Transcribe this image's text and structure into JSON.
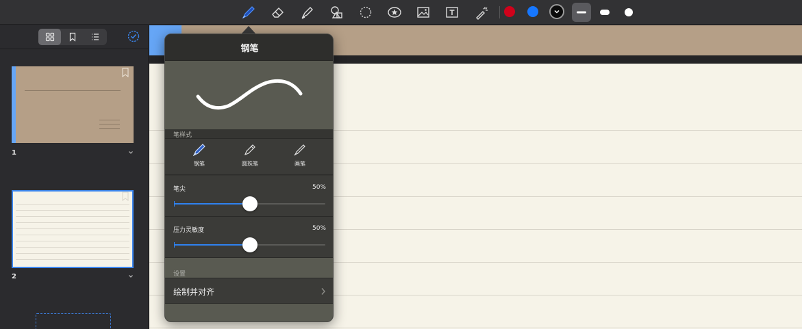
{
  "toolbar": {
    "tools": [
      {
        "id": "pen",
        "icon": "fountain-pen-icon",
        "active": true
      },
      {
        "id": "eraser",
        "icon": "eraser-icon"
      },
      {
        "id": "highlighter",
        "icon": "highlighter-icon"
      },
      {
        "id": "shapes",
        "icon": "shapes-icon"
      },
      {
        "id": "lasso",
        "icon": "lasso-icon"
      },
      {
        "id": "sticker",
        "icon": "star-sticker-icon"
      },
      {
        "id": "image",
        "icon": "image-icon"
      },
      {
        "id": "text",
        "icon": "text-box-icon"
      },
      {
        "id": "laser",
        "icon": "laser-pointer-icon"
      }
    ],
    "colors": [
      "#d0021b",
      "#1677ff",
      "#0b0b0b"
    ],
    "selected_color": "#0b0b0b",
    "widths": [
      "thin",
      "medium",
      "thick"
    ],
    "selected_width": "thin"
  },
  "sidebar": {
    "view_modes": [
      "grid-icon",
      "bookmark-icon",
      "list-icon"
    ],
    "selected_view": "grid-icon",
    "select_icon": "check-circle-icon",
    "pages": [
      {
        "number": "1",
        "style": "kraft"
      },
      {
        "number": "2",
        "style": "lined",
        "selected": true
      }
    ]
  },
  "popover": {
    "title": "钢笔",
    "pen_style_label": "笔样式",
    "styles": [
      {
        "label": "钢笔",
        "icon": "fountain-pen-icon",
        "active": true
      },
      {
        "label": "圆珠笔",
        "icon": "ballpoint-pen-icon"
      },
      {
        "label": "画笔",
        "icon": "brush-pen-icon"
      }
    ],
    "tip": {
      "label": "笔尖",
      "value_text": "50%",
      "value": 0.5
    },
    "pressure": {
      "label": "压力灵敏度",
      "value_text": "50%",
      "value": 0.5
    },
    "settings_label": "设置",
    "draw_and_snap": "绘制并对齐"
  },
  "colors": {
    "accent": "#2f82f0",
    "paper": "#f6f3e8",
    "kraft": "#b59f87",
    "page_accent": "#66a6f6"
  }
}
